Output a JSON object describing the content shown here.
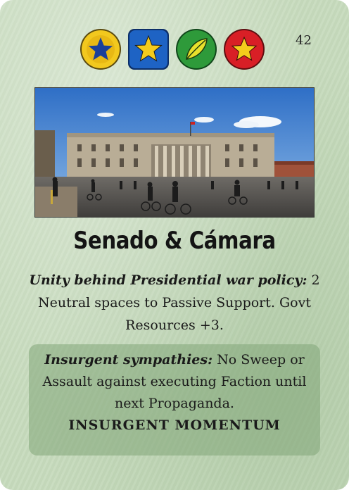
{
  "card": {
    "number": "42",
    "title": "Senado & Cámara",
    "faction_order": [
      {
        "name": "yellow-star-icon",
        "color": "#f2c81e",
        "shape": "circle",
        "star": "#1a3f9a"
      },
      {
        "name": "blue-star-icon",
        "color": "#1e63c4",
        "shape": "square",
        "star": "#f4cc1c"
      },
      {
        "name": "green-leaf-icon",
        "color": "#2e9a3a",
        "shape": "circle",
        "star": "#e8e02c"
      },
      {
        "name": "red-star-icon",
        "color": "#d81f26",
        "shape": "circle",
        "star": "#f4cc1c"
      }
    ],
    "unshaded": {
      "italic": "Unity behind Presidential war policy:",
      "text": " 2 Neutral spaces to Passive Support. Govt Resources +3."
    },
    "shaded": {
      "italic": "Insurgent sympathies:",
      "text": " No Sweep or Assault against executing Faction until next Propaganda.",
      "momentum": "INSURGENT MOMENTUM"
    }
  }
}
